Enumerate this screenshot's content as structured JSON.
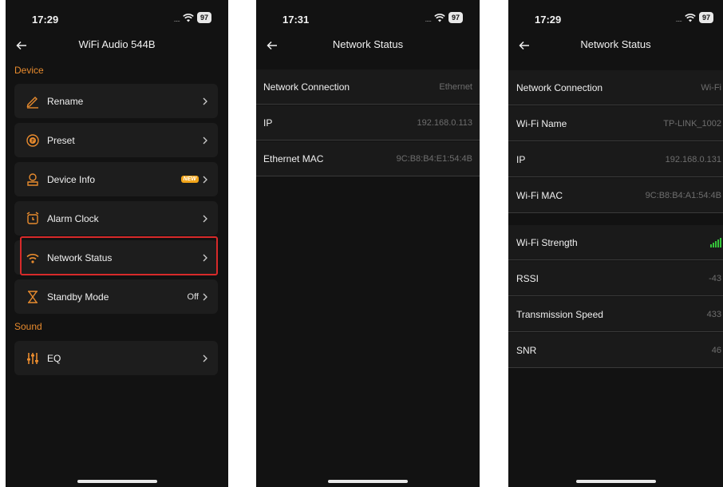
{
  "phone1": {
    "time": "17:29",
    "battery": "97",
    "title": "WiFi Audio 544B",
    "section_device": "Device",
    "section_sound": "Sound",
    "items": [
      {
        "label": "Rename",
        "icon": "pencil-icon"
      },
      {
        "label": "Preset",
        "icon": "preset-icon"
      },
      {
        "label": "Device Info",
        "icon": "person-icon",
        "badge": "NEW"
      },
      {
        "label": "Alarm Clock",
        "icon": "alarm-clock-icon"
      },
      {
        "label": "Network Status",
        "icon": "wifi-icon"
      },
      {
        "label": "Standby Mode",
        "icon": "hourglass-icon",
        "value": "Off"
      },
      {
        "label": "EQ",
        "icon": "equalizer-icon"
      }
    ]
  },
  "phone2": {
    "time": "17:31",
    "battery": "97",
    "title": "Network Status",
    "rows": [
      {
        "label": "Network Connection",
        "value": "Ethernet"
      },
      {
        "label": "IP",
        "value": "192.168.0.113"
      },
      {
        "label": "Ethernet MAC",
        "value": "9C:B8:B4:E1:54:4B"
      }
    ]
  },
  "phone3": {
    "time": "17:29",
    "battery": "97",
    "title": "Network Status",
    "rows": [
      {
        "label": "Network Connection",
        "value": "Wi-Fi"
      },
      {
        "label": "Wi-Fi Name",
        "value": "TP-LINK_1002"
      },
      {
        "label": "IP",
        "value": "192.168.0.131"
      },
      {
        "label": "Wi-Fi MAC",
        "value": "9C:B8:B4:A1:54:4B"
      },
      {
        "label": "Wi-Fi Strength",
        "value_icon": "signal-strength-icon"
      },
      {
        "label": "RSSI",
        "value": "-43"
      },
      {
        "label": "Transmission Speed",
        "value": "433"
      },
      {
        "label": "SNR",
        "value": "46"
      }
    ]
  },
  "colors": {
    "accent": "#e88b2e",
    "highlight": "#d72a2a",
    "signal": "#35c43a"
  }
}
